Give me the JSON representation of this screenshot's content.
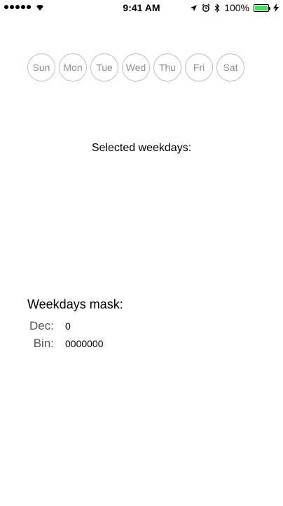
{
  "status_bar": {
    "time": "9:41 AM",
    "battery_percent": "100%",
    "battery_level": 1.0,
    "icons": [
      "signal-icon",
      "wifi-icon",
      "location-icon",
      "alarm-icon",
      "bluetooth-icon",
      "battery-icon",
      "charging-icon"
    ]
  },
  "weekdays": {
    "days": [
      "Sun",
      "Mon",
      "Tue",
      "Wed",
      "Thu",
      "Fri",
      "Sat"
    ]
  },
  "selected": {
    "title": "Selected weekdays:"
  },
  "mask": {
    "title": "Weekdays mask:",
    "dec_label": "Dec:",
    "dec_value": "0",
    "bin_label": "Bin:",
    "bin_value": "0000000"
  },
  "colors": {
    "day_border": "#bfbfbf",
    "day_text": "#8f8f8f",
    "battery_fill": "#4cd964"
  }
}
